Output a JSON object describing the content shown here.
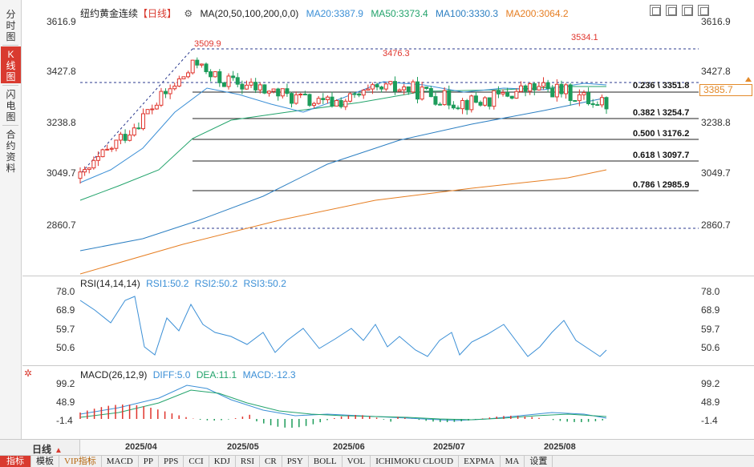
{
  "side_tabs": [
    {
      "label": "分时图",
      "active": false
    },
    {
      "label": "K线图",
      "active": true
    },
    {
      "label": "闪电图",
      "active": false
    },
    {
      "label": "合约资料",
      "active": false
    }
  ],
  "price_panel": {
    "instrument": "纽约黄金连续",
    "period": "【日线】",
    "ma_title": "MA(20,50,100,200,0,0)",
    "ma_values": [
      {
        "label": "MA20:3387.9",
        "color": "#3b8fd6"
      },
      {
        "label": "MA50:3373.4",
        "color": "#22a36b"
      },
      {
        "label": "MA100:3330.3",
        "color": "#2c7fc2"
      },
      {
        "label": "MA200:3064.2",
        "color": "#e67e22"
      }
    ],
    "y_ticks": [
      "3616.9",
      "3427.8",
      "3238.8",
      "3049.7",
      "2860.7"
    ],
    "high_mark_1": "3509.9",
    "high_mark_2": "3476.3",
    "high_mark_3": "3534.1",
    "current_price": "3385.7",
    "fib_levels": [
      "0.236 \\ 3351.8",
      "0.382 \\ 3254.7",
      "0.500 \\ 3176.2",
      "0.618 \\ 3097.7",
      "0.786 \\ 2985.9"
    ]
  },
  "rsi_panel": {
    "title": "RSI(14,14,14)",
    "values": [
      {
        "label": "RSI1:50.2",
        "color": "#3b8fd6"
      },
      {
        "label": "RSI2:50.2",
        "color": "#3b8fd6"
      },
      {
        "label": "RSI3:50.2",
        "color": "#3b8fd6"
      }
    ],
    "y_ticks": [
      "78.0",
      "68.9",
      "59.7",
      "50.6"
    ]
  },
  "macd_panel": {
    "title": "MACD(26,12,9)",
    "values": [
      {
        "label": "DIFF:5.0",
        "color": "#3b8fd6"
      },
      {
        "label": "DEA:11.1",
        "color": "#22a36b"
      },
      {
        "label": "MACD:-12.3",
        "color": "#3b8fd6"
      }
    ],
    "y_ticks": [
      "99.2",
      "48.9",
      "-1.4"
    ]
  },
  "period_button": "日线",
  "dates": [
    "2025/04",
    "2025/05",
    "2025/06",
    "2025/07",
    "2025/08"
  ],
  "indicator_tabs": [
    "指标",
    "模板",
    "VIP指标",
    "MACD",
    "PP",
    "PPS",
    "CCI",
    "KDJ",
    "RSI",
    "CR",
    "PSY",
    "BOLL",
    "VOL",
    "ICHIMOKU CLOUD",
    "EXPMA",
    "MA",
    "设置"
  ],
  "colors": {
    "up": "#e0342c",
    "down": "#1c9c5a",
    "ma20": "#3b8fd6",
    "ma50": "#22a36b",
    "ma200": "#e67e22",
    "fib": "#222222",
    "dashed": "#2b3a8f"
  }
}
